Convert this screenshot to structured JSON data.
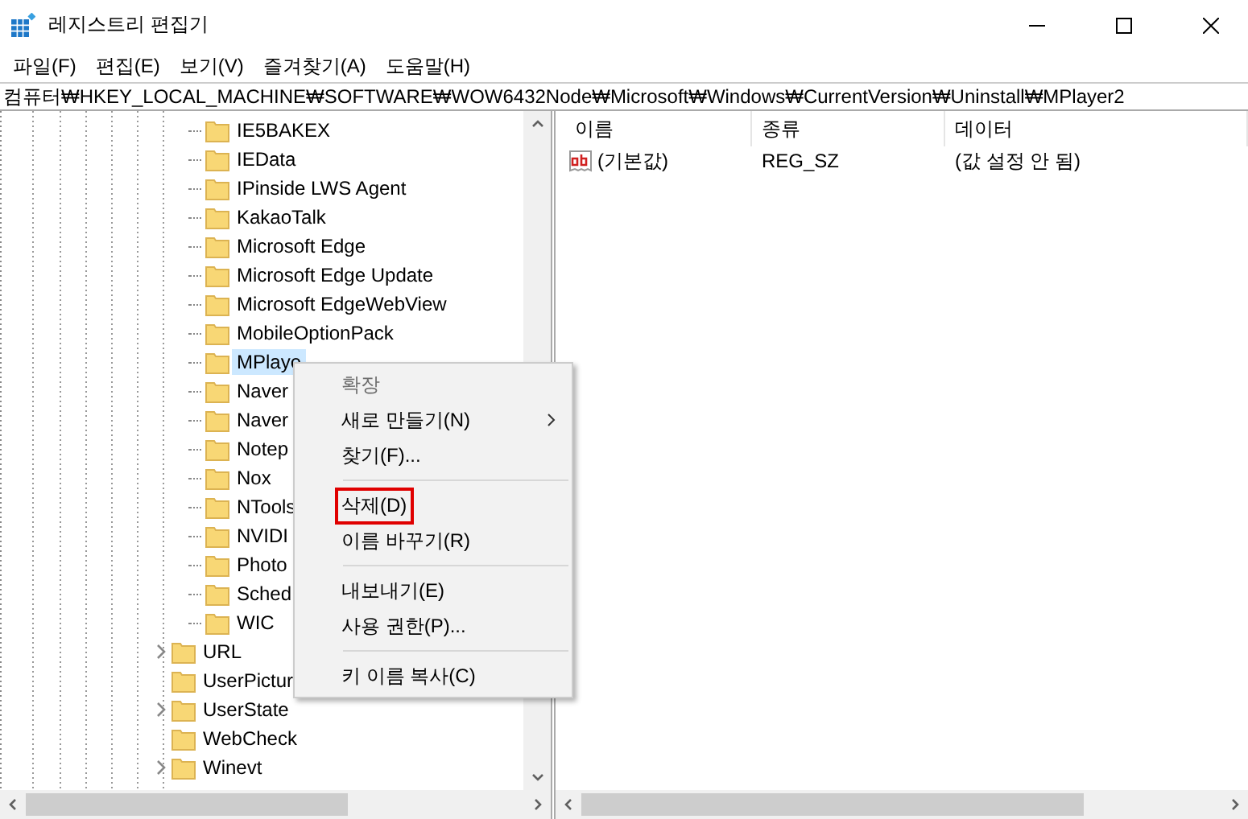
{
  "window": {
    "title": "레지스트리 편집기"
  },
  "menu": [
    "파일(F)",
    "편집(E)",
    "보기(V)",
    "즐겨찾기(A)",
    "도움말(H)"
  ],
  "address": "컴퓨터₩HKEY_LOCAL_MACHINE₩SOFTWARE₩WOW6432Node₩Microsoft₩Windows₩CurrentVersion₩Uninstall₩MPlayer2",
  "tree": {
    "inner_items": [
      {
        "label": "IE5BAKEX",
        "selected": false
      },
      {
        "label": "IEData",
        "selected": false
      },
      {
        "label": "IPinside LWS Agent",
        "selected": false
      },
      {
        "label": "KakaoTalk",
        "selected": false
      },
      {
        "label": "Microsoft Edge",
        "selected": false
      },
      {
        "label": "Microsoft Edge Update",
        "selected": false
      },
      {
        "label": "Microsoft EdgeWebView",
        "selected": false
      },
      {
        "label": "MobileOptionPack",
        "selected": false
      },
      {
        "label": "MPlaye",
        "selected": true
      },
      {
        "label": "Naver",
        "selected": false
      },
      {
        "label": "Naver",
        "selected": false
      },
      {
        "label": "Notep",
        "selected": false
      },
      {
        "label": "Nox",
        "selected": false
      },
      {
        "label": "NTools",
        "selected": false
      },
      {
        "label": "NVIDI",
        "selected": false
      },
      {
        "label": "Photo",
        "selected": false
      },
      {
        "label": "Sched",
        "selected": false
      },
      {
        "label": "WIC",
        "selected": false
      }
    ],
    "outer_items": [
      {
        "label": "URL",
        "expandable": true
      },
      {
        "label": "UserPictur",
        "expandable": false
      },
      {
        "label": "UserState",
        "expandable": true
      },
      {
        "label": "WebCheck",
        "expandable": false
      },
      {
        "label": "Winevt",
        "expandable": true
      }
    ]
  },
  "values": {
    "columns": [
      "이름",
      "종류",
      "데이터"
    ],
    "rows": [
      {
        "name": "(기본값)",
        "type": "REG_SZ",
        "data": "(값 설정 안 됨)"
      }
    ]
  },
  "context_menu": {
    "items": [
      {
        "kind": "item",
        "label": "확장",
        "disabled": true,
        "submenu": false,
        "highlighted": false
      },
      {
        "kind": "item",
        "label": "새로 만들기(N)",
        "disabled": false,
        "submenu": true,
        "highlighted": false
      },
      {
        "kind": "item",
        "label": "찾기(F)...",
        "disabled": false,
        "submenu": false,
        "highlighted": false
      },
      {
        "kind": "separator"
      },
      {
        "kind": "item",
        "label": "삭제(D)",
        "disabled": false,
        "submenu": false,
        "highlighted": true
      },
      {
        "kind": "item",
        "label": "이름 바꾸기(R)",
        "disabled": false,
        "submenu": false,
        "highlighted": false
      },
      {
        "kind": "separator"
      },
      {
        "kind": "item",
        "label": "내보내기(E)",
        "disabled": false,
        "submenu": false,
        "highlighted": false
      },
      {
        "kind": "item",
        "label": "사용 권한(P)...",
        "disabled": false,
        "submenu": false,
        "highlighted": false
      },
      {
        "kind": "separator"
      },
      {
        "kind": "item",
        "label": "키 이름 복사(C)",
        "disabled": false,
        "submenu": false,
        "highlighted": false
      }
    ]
  }
}
